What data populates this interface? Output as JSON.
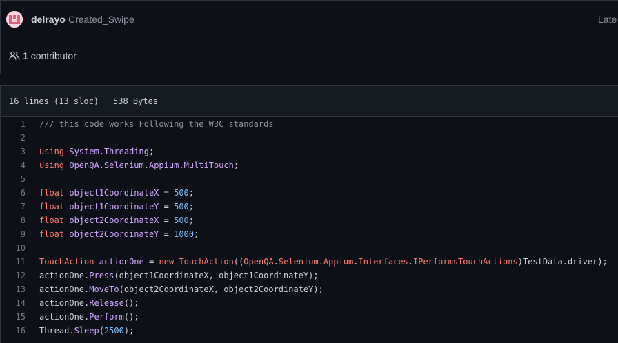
{
  "commit": {
    "author": "delrayo",
    "message": "Created_Swipe",
    "latest_label": "Late"
  },
  "contributors": {
    "count": "1",
    "label": "contributor"
  },
  "file": {
    "lines_info": "16 lines (13 sloc)",
    "size": "538 Bytes"
  },
  "code": {
    "lines": [
      {
        "num": "1",
        "tokens": [
          {
            "t": "/// this code works Following the W3C standards",
            "c": "cm"
          }
        ]
      },
      {
        "num": "2",
        "tokens": []
      },
      {
        "num": "3",
        "tokens": [
          {
            "t": "using",
            "c": "kw"
          },
          {
            "t": " ",
            "c": "plain"
          },
          {
            "t": "System",
            "c": "id"
          },
          {
            "t": ".",
            "c": "plain"
          },
          {
            "t": "Threading",
            "c": "id"
          },
          {
            "t": ";",
            "c": "plain"
          }
        ]
      },
      {
        "num": "4",
        "tokens": [
          {
            "t": "using",
            "c": "kw"
          },
          {
            "t": " ",
            "c": "plain"
          },
          {
            "t": "OpenQA",
            "c": "id"
          },
          {
            "t": ".",
            "c": "plain"
          },
          {
            "t": "Selenium",
            "c": "id"
          },
          {
            "t": ".",
            "c": "plain"
          },
          {
            "t": "Appium",
            "c": "id"
          },
          {
            "t": ".",
            "c": "plain"
          },
          {
            "t": "MultiTouch",
            "c": "id"
          },
          {
            "t": ";",
            "c": "plain"
          }
        ]
      },
      {
        "num": "5",
        "tokens": []
      },
      {
        "num": "6",
        "tokens": [
          {
            "t": "float",
            "c": "kw"
          },
          {
            "t": " ",
            "c": "plain"
          },
          {
            "t": "object1CoordinateX",
            "c": "id"
          },
          {
            "t": " = ",
            "c": "plain"
          },
          {
            "t": "500",
            "c": "num"
          },
          {
            "t": ";",
            "c": "plain"
          }
        ]
      },
      {
        "num": "7",
        "tokens": [
          {
            "t": "float",
            "c": "kw"
          },
          {
            "t": " ",
            "c": "plain"
          },
          {
            "t": "object1CoordinateY",
            "c": "id"
          },
          {
            "t": " = ",
            "c": "plain"
          },
          {
            "t": "500",
            "c": "num"
          },
          {
            "t": ";",
            "c": "plain"
          }
        ]
      },
      {
        "num": "8",
        "tokens": [
          {
            "t": "float",
            "c": "kw"
          },
          {
            "t": " ",
            "c": "plain"
          },
          {
            "t": "object2CoordinateX",
            "c": "id"
          },
          {
            "t": " = ",
            "c": "plain"
          },
          {
            "t": "500",
            "c": "num"
          },
          {
            "t": ";",
            "c": "plain"
          }
        ]
      },
      {
        "num": "9",
        "tokens": [
          {
            "t": "float",
            "c": "kw"
          },
          {
            "t": " ",
            "c": "plain"
          },
          {
            "t": "object2CoordinateY",
            "c": "id"
          },
          {
            "t": " = ",
            "c": "plain"
          },
          {
            "t": "1000",
            "c": "num"
          },
          {
            "t": ";",
            "c": "plain"
          }
        ]
      },
      {
        "num": "10",
        "tokens": []
      },
      {
        "num": "11",
        "tokens": [
          {
            "t": "TouchAction",
            "c": "kw"
          },
          {
            "t": " ",
            "c": "plain"
          },
          {
            "t": "actionOne",
            "c": "id"
          },
          {
            "t": " = ",
            "c": "plain"
          },
          {
            "t": "new",
            "c": "kw"
          },
          {
            "t": " ",
            "c": "plain"
          },
          {
            "t": "TouchAction",
            "c": "kw"
          },
          {
            "t": "((",
            "c": "plain"
          },
          {
            "t": "OpenQA",
            "c": "kw"
          },
          {
            "t": ".",
            "c": "plain"
          },
          {
            "t": "Selenium",
            "c": "kw"
          },
          {
            "t": ".",
            "c": "plain"
          },
          {
            "t": "Appium",
            "c": "kw"
          },
          {
            "t": ".",
            "c": "plain"
          },
          {
            "t": "Interfaces",
            "c": "kw"
          },
          {
            "t": ".",
            "c": "plain"
          },
          {
            "t": "IPerformsTouchActions",
            "c": "kw"
          },
          {
            "t": ")TestData.driver);",
            "c": "plain"
          }
        ]
      },
      {
        "num": "12",
        "tokens": [
          {
            "t": "actionOne.",
            "c": "plain"
          },
          {
            "t": "Press",
            "c": "id"
          },
          {
            "t": "(object1CoordinateX, object1CoordinateY);",
            "c": "plain"
          }
        ]
      },
      {
        "num": "13",
        "tokens": [
          {
            "t": "actionOne.",
            "c": "plain"
          },
          {
            "t": "MoveTo",
            "c": "id"
          },
          {
            "t": "(object2CoordinateX, object2CoordinateY);",
            "c": "plain"
          }
        ]
      },
      {
        "num": "14",
        "tokens": [
          {
            "t": "actionOne.",
            "c": "plain"
          },
          {
            "t": "Release",
            "c": "id"
          },
          {
            "t": "();",
            "c": "plain"
          }
        ]
      },
      {
        "num": "15",
        "tokens": [
          {
            "t": "actionOne.",
            "c": "plain"
          },
          {
            "t": "Perform",
            "c": "id"
          },
          {
            "t": "();",
            "c": "plain"
          }
        ]
      },
      {
        "num": "16",
        "tokens": [
          {
            "t": "Thread.",
            "c": "plain"
          },
          {
            "t": "Sleep",
            "c": "id"
          },
          {
            "t": "(",
            "c": "plain"
          },
          {
            "t": "2500",
            "c": "num"
          },
          {
            "t": ");",
            "c": "plain"
          }
        ]
      }
    ]
  },
  "colors": {
    "background": "#0d1117",
    "header_bg": "#161b22",
    "keyword": "#ff7b72",
    "identifier": "#d2a8ff",
    "number": "#79c0ff",
    "comment": "#8b949e"
  }
}
